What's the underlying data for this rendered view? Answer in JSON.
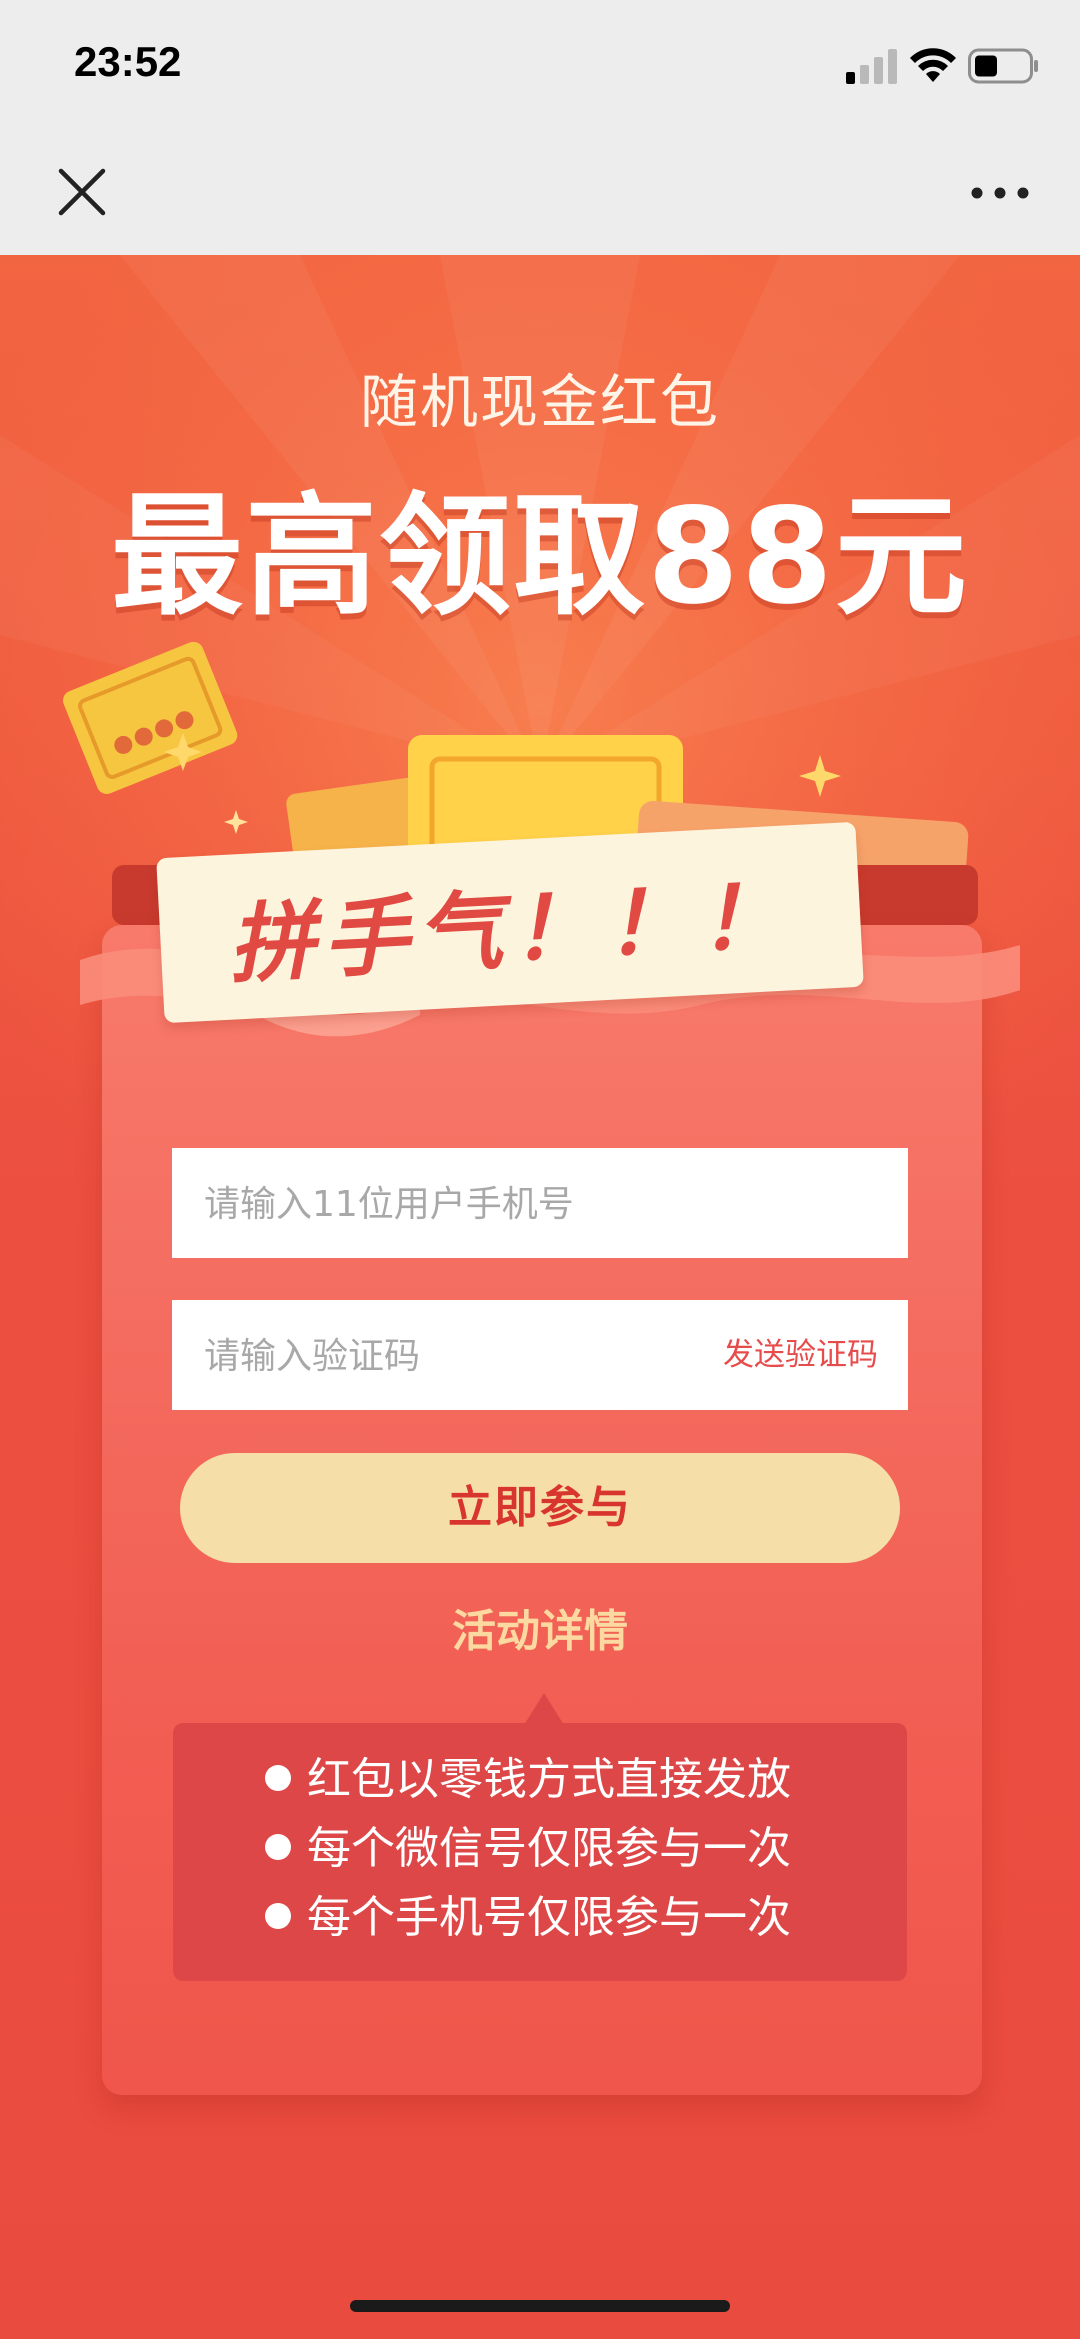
{
  "status_bar": {
    "time": "23:52",
    "icons": [
      "signal-icon",
      "wifi-icon",
      "battery-icon"
    ]
  },
  "nav_bar": {
    "close_icon": "close-icon",
    "more_icon": "more-icon"
  },
  "hero": {
    "subtitle": "随机现金红包",
    "headline": "最高领取88元"
  },
  "banner": {
    "text": "拼手气！！！"
  },
  "form": {
    "phone_placeholder": "请输入11位用户手机号",
    "code_placeholder": "请输入验证码",
    "send_code_label": "发送验证码",
    "join_button_label": "立即参与"
  },
  "details": {
    "link_label": "活动详情",
    "rules": [
      "红包以零钱方式直接发放",
      "每个微信号仅限参与一次",
      "每个手机号仅限参与一次"
    ]
  },
  "colors": {
    "background": "#ea4b3f",
    "card": "#f46e61",
    "button": "#f6dea8",
    "button_text": "#d8352f",
    "link": "#fcd9a0",
    "rules_box": "#de4747",
    "send_code": "#e74c4c"
  }
}
